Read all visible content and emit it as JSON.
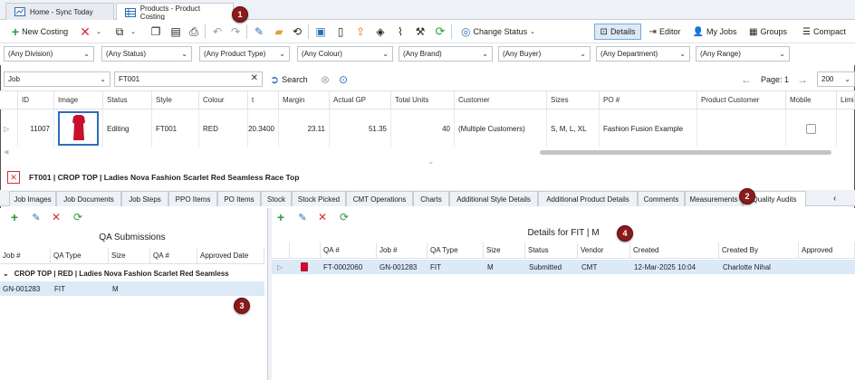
{
  "window_tabs": [
    {
      "label": "Home - Sync Today",
      "icon": "chart-icon",
      "active": false
    },
    {
      "label": "Products - Product Costing",
      "icon": "grid-icon",
      "active": true
    }
  ],
  "toolbar": {
    "new_costing": "New Costing",
    "change_status": "Change Status",
    "details": "Details",
    "editor": "Editor",
    "my_jobs": "My Jobs",
    "groups": "Groups",
    "compact": "Compact"
  },
  "filters": [
    "(Any Division)",
    "(Any Status)",
    "(Any Product Type)",
    "(Any Colour)",
    "(Any Brand)",
    "(Any Buyer)",
    "(Any Department)",
    "(Any Range)"
  ],
  "search": {
    "field": "Job",
    "value": "FT001",
    "button": "Search",
    "page_label": "Page: 1",
    "page_size": "200"
  },
  "grid": {
    "headers": [
      "ID",
      "Image",
      "Status",
      "Style",
      "Colour",
      "t",
      "Margin",
      "Actual GP",
      "Total Units",
      "Customer",
      "Sizes",
      "PO #",
      "Product Customer",
      "Mobile",
      "Limi"
    ],
    "row": {
      "id": "11007",
      "status": "Editing",
      "style": "FT001",
      "colour": "RED",
      "cost": "20.3400",
      "margin": "23.11",
      "actual_gp": "51.35",
      "total_units": "40",
      "customer": "(Multiple Customers)",
      "sizes": "S, M, L, XL",
      "po": "Fashion Fusion Example"
    }
  },
  "detail_title": "FT001 | CROP TOP | Ladies Nova Fashion Scarlet Red Seamless Race Top",
  "sub_tabs": [
    "Job Images",
    "Job Documents",
    "Job Steps",
    "PPO Items",
    "PO Items",
    "Stock",
    "Stock Picked",
    "CMT Operations",
    "Charts",
    "Additional Style Details",
    "Additional Product Details",
    "Comments",
    "Measurements",
    "Quality Audits"
  ],
  "qa_submissions": {
    "title": "QA Submissions",
    "headers": [
      "Job #",
      "QA Type",
      "Size",
      "QA #",
      "Approved Date"
    ],
    "group": "CROP TOP | RED | Ladies Nova Fashion Scarlet Red Seamless",
    "rows": [
      {
        "job": "GN-001283",
        "qa_type": "FIT",
        "size": "M"
      }
    ]
  },
  "details": {
    "title": "Details for FIT | M",
    "headers": [
      "QA #",
      "Job #",
      "QA Type",
      "Size",
      "Status",
      "Vendor",
      "Created",
      "Created By",
      "Approved"
    ],
    "rows": [
      {
        "qa": "FT-0002060",
        "job": "GN-001283",
        "qa_type": "FIT",
        "size": "M",
        "status": "Submitted",
        "vendor": "CMT",
        "created": "12-Mar-2025 10:04",
        "created_by": "Charlotte Nihal"
      }
    ]
  },
  "callouts": [
    "1",
    "2",
    "3",
    "4"
  ],
  "colors": {
    "accent": "#2f6db5",
    "badge": "#8b1a1a",
    "green": "#2e9a3e",
    "red": "#d32f2f",
    "selection": "#dce9f7"
  }
}
